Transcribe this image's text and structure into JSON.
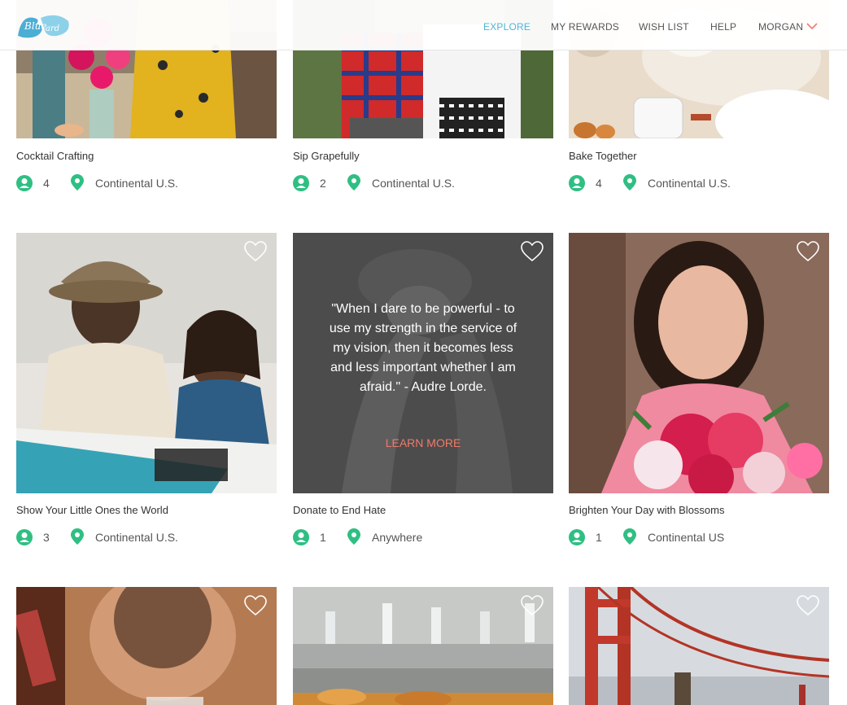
{
  "brand": {
    "logo_text": "Blue Board",
    "accent_color": "#4fb3d9",
    "icon_color": "#2fbf83"
  },
  "nav": {
    "explore": "EXPLORE",
    "my_rewards": "MY REWARDS",
    "wish_list": "WISH LIST",
    "help": "HELP",
    "user": "MORGAN"
  },
  "cards": [
    {
      "title": "Cocktail Crafting",
      "people": "4",
      "location": "Continental U.S."
    },
    {
      "title": "Sip Grapefully",
      "people": "2",
      "location": "Continental U.S."
    },
    {
      "title": "Bake Together",
      "people": "4",
      "location": "Continental U.S."
    },
    {
      "title": "Show Your Little Ones the World",
      "people": "3",
      "location": "Continental U.S."
    },
    {
      "title": "Donate to End Hate",
      "people": "1",
      "location": "Anywhere",
      "quote": "\"When I dare to be powerful - to use my strength in the service of my vision, then it becomes less and less important whether I am afraid.\" - Audre Lorde.",
      "cta": "LEARN MORE"
    },
    {
      "title": "Brighten Your Day with Blossoms",
      "people": "1",
      "location": "Continental US"
    },
    {
      "title": "",
      "people": "",
      "location": ""
    },
    {
      "title": "",
      "people": "",
      "location": ""
    },
    {
      "title": "",
      "people": "",
      "location": ""
    }
  ]
}
